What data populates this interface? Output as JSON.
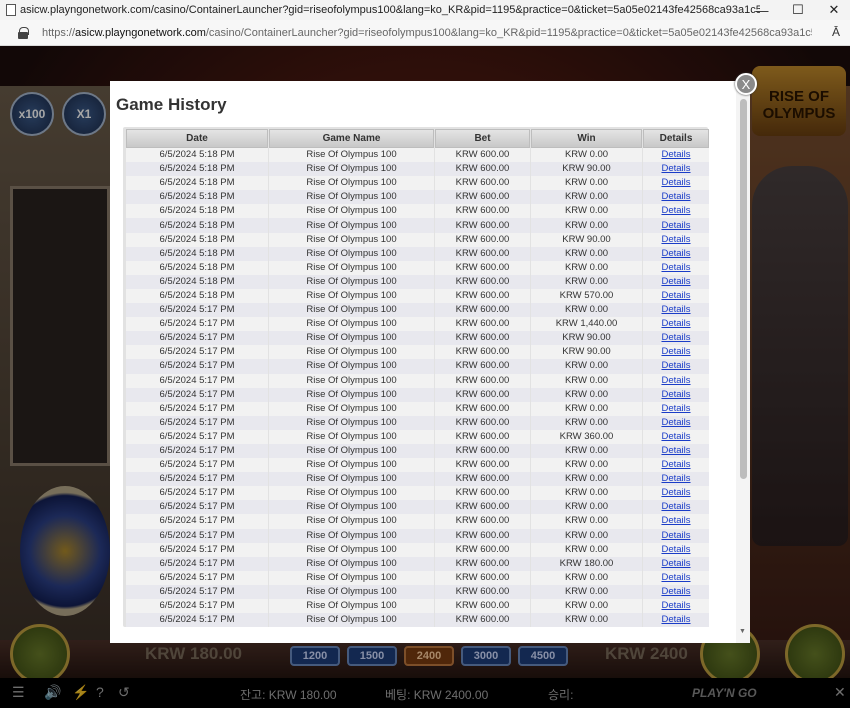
{
  "browser": {
    "tab_title": "asicw.playngonetwork.com/casino/ContainerLauncher?gid=riseofolympus100&lang=ko_KR&pid=1195&practice=0&ticket=5a05e02143fe42568ca93a1c54d9db64...",
    "url_scheme": "https://",
    "url_host": "asicw.playngonetwork.com",
    "url_path": "/casino/ContainerLauncher?gid=riseofolympus100&lang=ko_KR&pid=1195&practice=0&ticket=5a05e02143fe42568ca93a1c54d9db64...",
    "minimize_glyph": "—",
    "maximize_glyph": "☐",
    "close_glyph": "✕",
    "reader_glyph": "Ā"
  },
  "game": {
    "logo_text": "RISE OF OLYMPUS",
    "btn_x100": "x100",
    "btn_x1": "X1",
    "win_amount": "KRW 180.00",
    "bet_amount": "KRW 2400",
    "bet_chips": [
      "1200",
      "1500",
      "2400",
      "3000",
      "4500"
    ],
    "balance_label": "잔고: KRW 180.00",
    "bet_label": "베팅: KRW 2400.00",
    "win_label": "승리:",
    "brand": "PLAY'N GO",
    "menu_glyph": "☰",
    "sound_glyph": "🔊",
    "bolt_glyph": "⚡",
    "help_glyph": "?",
    "history_glyph": "↺",
    "close_glyph": "✕"
  },
  "modal": {
    "title": "Game History",
    "close_label": "X",
    "columns": [
      "Date",
      "Game Name",
      "Bet",
      "Win",
      "Details"
    ],
    "rows": [
      {
        "date": "6/5/2024 5:18 PM",
        "game": "Rise Of Olympus 100",
        "bet": "KRW 600.00",
        "win": "KRW 0.00",
        "details": "Details"
      },
      {
        "date": "6/5/2024 5:18 PM",
        "game": "Rise Of Olympus 100",
        "bet": "KRW 600.00",
        "win": "KRW 90.00",
        "details": "Details"
      },
      {
        "date": "6/5/2024 5:18 PM",
        "game": "Rise Of Olympus 100",
        "bet": "KRW 600.00",
        "win": "KRW 0.00",
        "details": "Details"
      },
      {
        "date": "6/5/2024 5:18 PM",
        "game": "Rise Of Olympus 100",
        "bet": "KRW 600.00",
        "win": "KRW 0.00",
        "details": "Details"
      },
      {
        "date": "6/5/2024 5:18 PM",
        "game": "Rise Of Olympus 100",
        "bet": "KRW 600.00",
        "win": "KRW 0.00",
        "details": "Details"
      },
      {
        "date": "6/5/2024 5:18 PM",
        "game": "Rise Of Olympus 100",
        "bet": "KRW 600.00",
        "win": "KRW 0.00",
        "details": "Details"
      },
      {
        "date": "6/5/2024 5:18 PM",
        "game": "Rise Of Olympus 100",
        "bet": "KRW 600.00",
        "win": "KRW 90.00",
        "details": "Details"
      },
      {
        "date": "6/5/2024 5:18 PM",
        "game": "Rise Of Olympus 100",
        "bet": "KRW 600.00",
        "win": "KRW 0.00",
        "details": "Details"
      },
      {
        "date": "6/5/2024 5:18 PM",
        "game": "Rise Of Olympus 100",
        "bet": "KRW 600.00",
        "win": "KRW 0.00",
        "details": "Details"
      },
      {
        "date": "6/5/2024 5:18 PM",
        "game": "Rise Of Olympus 100",
        "bet": "KRW 600.00",
        "win": "KRW 0.00",
        "details": "Details"
      },
      {
        "date": "6/5/2024 5:18 PM",
        "game": "Rise Of Olympus 100",
        "bet": "KRW 600.00",
        "win": "KRW 570.00",
        "details": "Details"
      },
      {
        "date": "6/5/2024 5:17 PM",
        "game": "Rise Of Olympus 100",
        "bet": "KRW 600.00",
        "win": "KRW 0.00",
        "details": "Details"
      },
      {
        "date": "6/5/2024 5:17 PM",
        "game": "Rise Of Olympus 100",
        "bet": "KRW 600.00",
        "win": "KRW 1,440.00",
        "details": "Details"
      },
      {
        "date": "6/5/2024 5:17 PM",
        "game": "Rise Of Olympus 100",
        "bet": "KRW 600.00",
        "win": "KRW 90.00",
        "details": "Details"
      },
      {
        "date": "6/5/2024 5:17 PM",
        "game": "Rise Of Olympus 100",
        "bet": "KRW 600.00",
        "win": "KRW 90.00",
        "details": "Details"
      },
      {
        "date": "6/5/2024 5:17 PM",
        "game": "Rise Of Olympus 100",
        "bet": "KRW 600.00",
        "win": "KRW 0.00",
        "details": "Details"
      },
      {
        "date": "6/5/2024 5:17 PM",
        "game": "Rise Of Olympus 100",
        "bet": "KRW 600.00",
        "win": "KRW 0.00",
        "details": "Details"
      },
      {
        "date": "6/5/2024 5:17 PM",
        "game": "Rise Of Olympus 100",
        "bet": "KRW 600.00",
        "win": "KRW 0.00",
        "details": "Details"
      },
      {
        "date": "6/5/2024 5:17 PM",
        "game": "Rise Of Olympus 100",
        "bet": "KRW 600.00",
        "win": "KRW 0.00",
        "details": "Details"
      },
      {
        "date": "6/5/2024 5:17 PM",
        "game": "Rise Of Olympus 100",
        "bet": "KRW 600.00",
        "win": "KRW 0.00",
        "details": "Details"
      },
      {
        "date": "6/5/2024 5:17 PM",
        "game": "Rise Of Olympus 100",
        "bet": "KRW 600.00",
        "win": "KRW 360.00",
        "details": "Details"
      },
      {
        "date": "6/5/2024 5:17 PM",
        "game": "Rise Of Olympus 100",
        "bet": "KRW 600.00",
        "win": "KRW 0.00",
        "details": "Details"
      },
      {
        "date": "6/5/2024 5:17 PM",
        "game": "Rise Of Olympus 100",
        "bet": "KRW 600.00",
        "win": "KRW 0.00",
        "details": "Details"
      },
      {
        "date": "6/5/2024 5:17 PM",
        "game": "Rise Of Olympus 100",
        "bet": "KRW 600.00",
        "win": "KRW 0.00",
        "details": "Details"
      },
      {
        "date": "6/5/2024 5:17 PM",
        "game": "Rise Of Olympus 100",
        "bet": "KRW 600.00",
        "win": "KRW 0.00",
        "details": "Details"
      },
      {
        "date": "6/5/2024 5:17 PM",
        "game": "Rise Of Olympus 100",
        "bet": "KRW 600.00",
        "win": "KRW 0.00",
        "details": "Details"
      },
      {
        "date": "6/5/2024 5:17 PM",
        "game": "Rise Of Olympus 100",
        "bet": "KRW 600.00",
        "win": "KRW 0.00",
        "details": "Details"
      },
      {
        "date": "6/5/2024 5:17 PM",
        "game": "Rise Of Olympus 100",
        "bet": "KRW 600.00",
        "win": "KRW 0.00",
        "details": "Details"
      },
      {
        "date": "6/5/2024 5:17 PM",
        "game": "Rise Of Olympus 100",
        "bet": "KRW 600.00",
        "win": "KRW 0.00",
        "details": "Details"
      },
      {
        "date": "6/5/2024 5:17 PM",
        "game": "Rise Of Olympus 100",
        "bet": "KRW 600.00",
        "win": "KRW 180.00",
        "details": "Details"
      },
      {
        "date": "6/5/2024 5:17 PM",
        "game": "Rise Of Olympus 100",
        "bet": "KRW 600.00",
        "win": "KRW 0.00",
        "details": "Details"
      },
      {
        "date": "6/5/2024 5:17 PM",
        "game": "Rise Of Olympus 100",
        "bet": "KRW 600.00",
        "win": "KRW 0.00",
        "details": "Details"
      },
      {
        "date": "6/5/2024 5:17 PM",
        "game": "Rise Of Olympus 100",
        "bet": "KRW 600.00",
        "win": "KRW 0.00",
        "details": "Details"
      },
      {
        "date": "6/5/2024 5:17 PM",
        "game": "Rise Of Olympus 100",
        "bet": "KRW 600.00",
        "win": "KRW 0.00",
        "details": "Details"
      }
    ]
  }
}
